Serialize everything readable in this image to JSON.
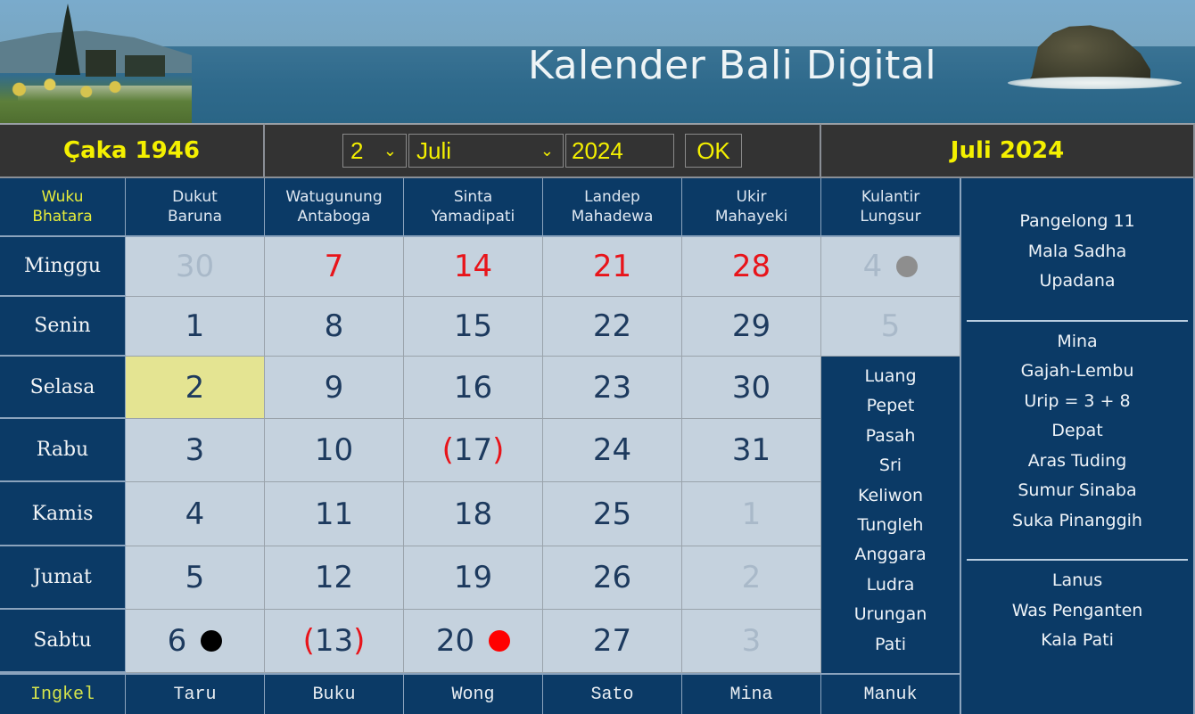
{
  "banner": {
    "title": "Kalender Bali Digital"
  },
  "controls": {
    "caka_label": "Çaka 1946",
    "day_select": {
      "selected": "2"
    },
    "month_select": {
      "selected": "Juli"
    },
    "year_input": {
      "value": "2024"
    },
    "ok_label": "OK",
    "month_year_label": "Juli 2024",
    "chevron_glyph": "⌄"
  },
  "wuku_header": {
    "corner": {
      "line1": "Wuku",
      "line2": "Bhatara"
    },
    "weeks": [
      {
        "line1": "Dukut",
        "line2": "Baruna"
      },
      {
        "line1": "Watugunung",
        "line2": "Antaboga"
      },
      {
        "line1": "Sinta",
        "line2": "Yamadipati"
      },
      {
        "line1": "Landep",
        "line2": "Mahadewa"
      },
      {
        "line1": "Ukir",
        "line2": "Mahayeki"
      },
      {
        "line1": "Kulantir",
        "line2": "Lungsur"
      }
    ]
  },
  "day_names": [
    "Minggu",
    "Senin",
    "Selasa",
    "Rabu",
    "Kamis",
    "Jumat",
    "Sabtu"
  ],
  "weeks": [
    {
      "days": [
        {
          "label": "30",
          "style": "faded"
        },
        {
          "label": "1",
          "style": "normal"
        },
        {
          "label": "2",
          "style": "today"
        },
        {
          "label": "3",
          "style": "normal"
        },
        {
          "label": "4",
          "style": "normal"
        },
        {
          "label": "5",
          "style": "normal"
        },
        {
          "label": "6",
          "style": "normal",
          "marker": "black-dot",
          "marker_color": "#000000"
        }
      ]
    },
    {
      "days": [
        {
          "label": "7",
          "style": "red"
        },
        {
          "label": "8",
          "style": "normal"
        },
        {
          "label": "9",
          "style": "normal"
        },
        {
          "label": "10",
          "style": "normal"
        },
        {
          "label": "11",
          "style": "normal"
        },
        {
          "label": "12",
          "style": "normal"
        },
        {
          "label": "13",
          "style": "parenthesized"
        }
      ]
    },
    {
      "days": [
        {
          "label": "14",
          "style": "red"
        },
        {
          "label": "15",
          "style": "normal"
        },
        {
          "label": "16",
          "style": "normal"
        },
        {
          "label": "17",
          "style": "parenthesized"
        },
        {
          "label": "18",
          "style": "normal"
        },
        {
          "label": "19",
          "style": "normal"
        },
        {
          "label": "20",
          "style": "normal",
          "marker": "red-dot",
          "marker_color": "#ff0000"
        }
      ]
    },
    {
      "days": [
        {
          "label": "21",
          "style": "red"
        },
        {
          "label": "22",
          "style": "normal"
        },
        {
          "label": "23",
          "style": "normal"
        },
        {
          "label": "24",
          "style": "normal"
        },
        {
          "label": "25",
          "style": "normal"
        },
        {
          "label": "26",
          "style": "normal"
        },
        {
          "label": "27",
          "style": "normal"
        }
      ]
    },
    {
      "days": [
        {
          "label": "28",
          "style": "red"
        },
        {
          "label": "29",
          "style": "normal"
        },
        {
          "label": "30",
          "style": "normal"
        },
        {
          "label": "31",
          "style": "normal"
        },
        {
          "label": "1",
          "style": "faded"
        },
        {
          "label": "2",
          "style": "faded"
        },
        {
          "label": "3",
          "style": "faded"
        }
      ]
    },
    {
      "days": [
        {
          "label": "4",
          "style": "faded",
          "marker": "gray-dot",
          "marker_color": "#8e8e8e"
        },
        {
          "label": "5",
          "style": "faded"
        }
      ]
    }
  ],
  "day_info": [
    "Luang",
    "Pepet",
    "Pasah",
    "Sri",
    "Keliwon",
    "Tungleh",
    "Anggara",
    "Ludra",
    "Urungan",
    "Pati"
  ],
  "side_panel": {
    "block1": [
      "Pangelong 11",
      "Mala Sadha",
      "Upadana"
    ],
    "block2": [
      "Mina",
      "Gajah-Lembu",
      "Urip = 3 + 8",
      "Depat",
      "Aras Tuding",
      "Sumur Sinaba",
      "Suka Pinanggih"
    ],
    "block3": [
      "Lanus",
      "Was Penganten",
      "Kala Pati"
    ]
  },
  "footer": {
    "corner": "Ingkel",
    "ingkel": [
      "Taru",
      "Buku",
      "Wong",
      "Sato",
      "Mina",
      "Manuk"
    ]
  },
  "colors": {
    "accent_yellow": "#f4f000",
    "holiday_red": "#e8141a",
    "today_highlight": "#e4e492",
    "navy": "#0b3a66",
    "cell_bg": "#c5d2de"
  }
}
